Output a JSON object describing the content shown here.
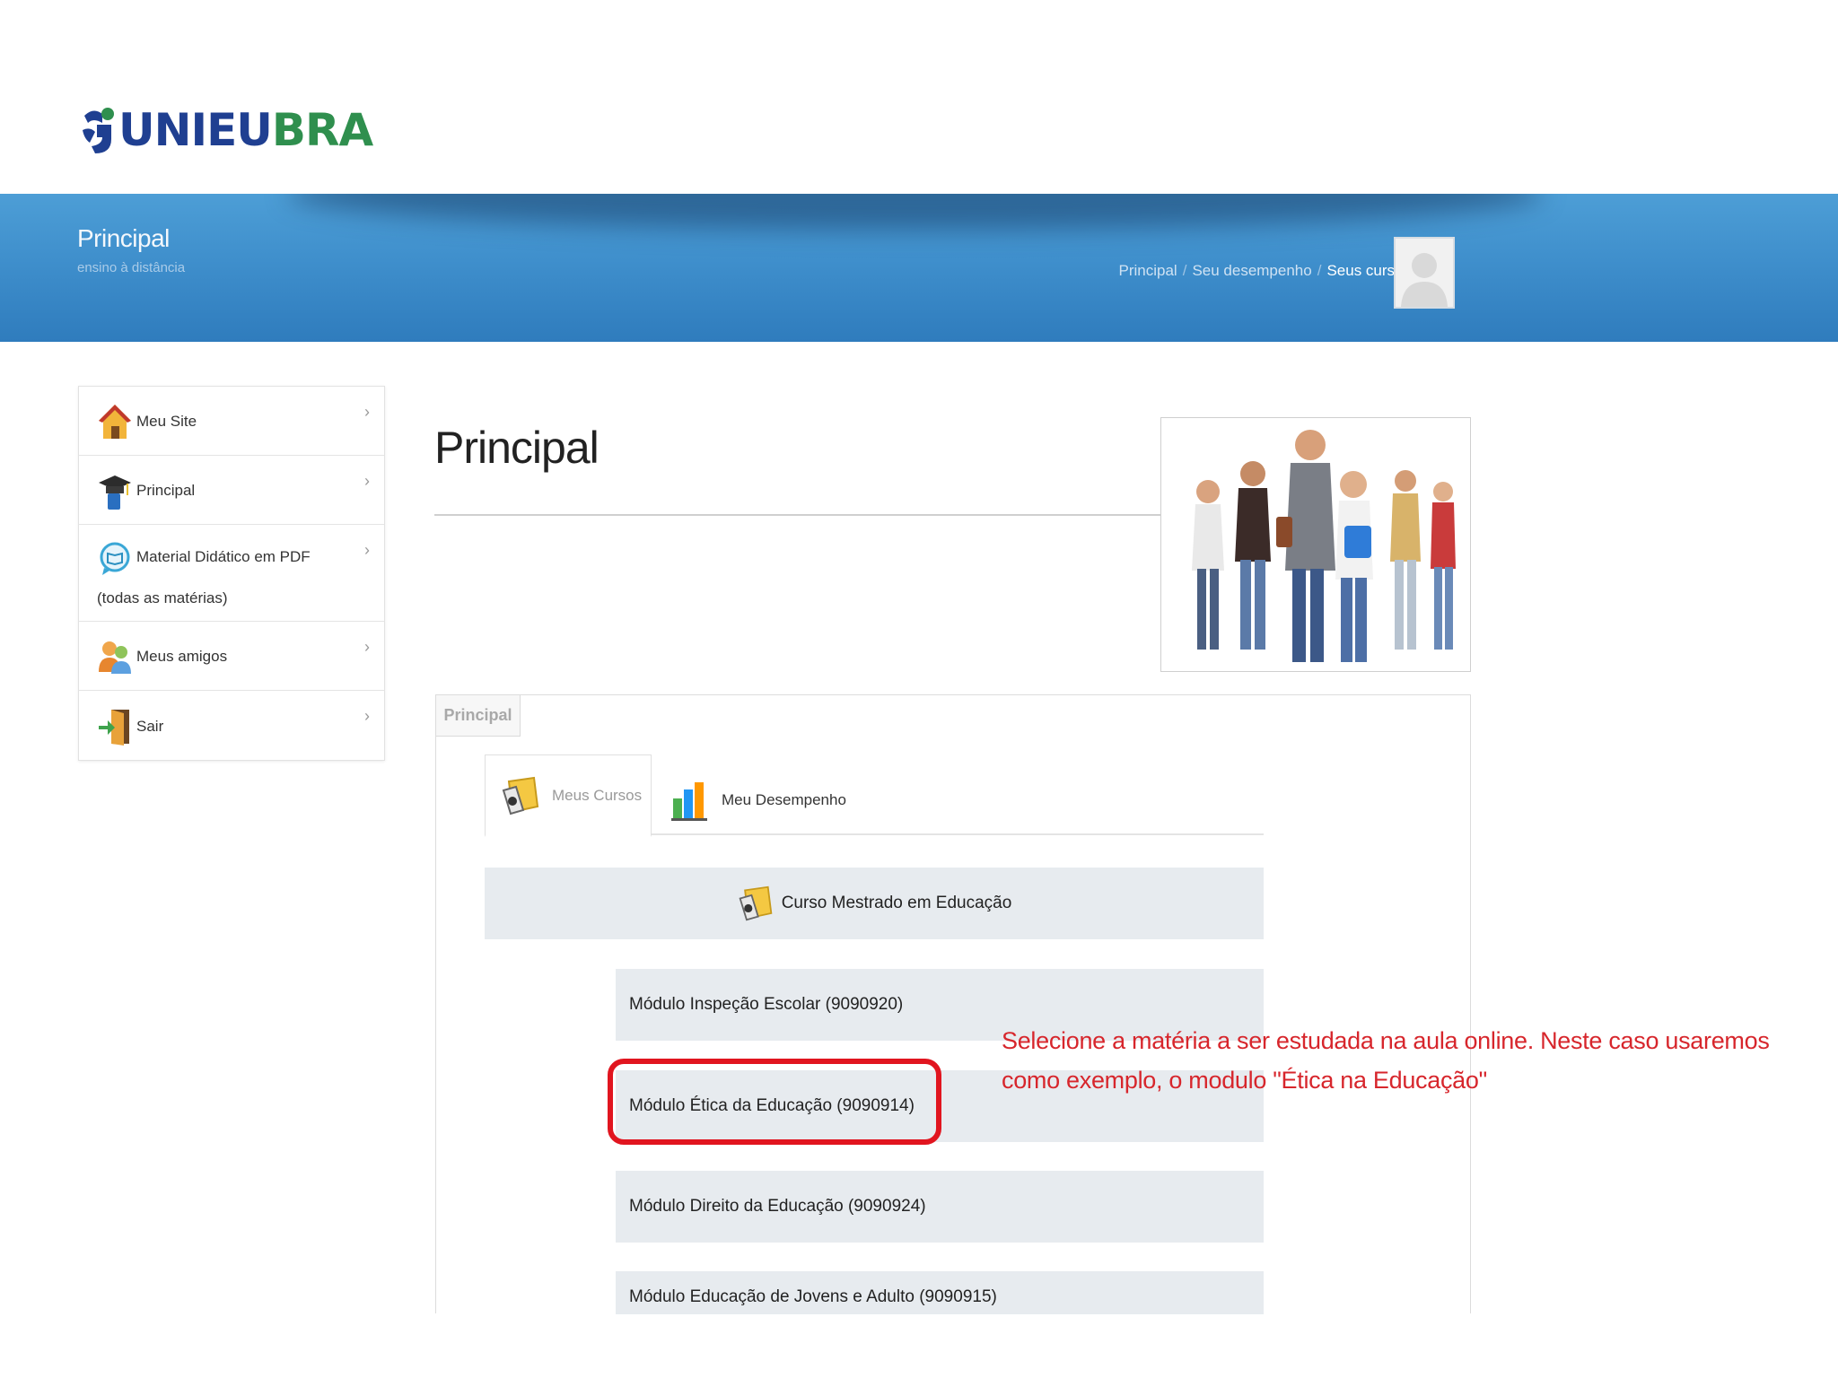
{
  "brand": {
    "logo_uni": "UNI",
    "logo_eu": "EU",
    "logo_bra": "BRA",
    "blue": "#1f3f91",
    "green": "#2f8f4e"
  },
  "header": {
    "title": "Principal",
    "subtitle": "ensino à distância",
    "breadcrumb": [
      "Principal",
      "Seu desempenho",
      "Seus cursos"
    ],
    "separator": "/",
    "band_color": "#3f8fcc"
  },
  "sidebar": {
    "items": [
      {
        "label": "Meu Site",
        "icon": "house-icon"
      },
      {
        "label": "Principal",
        "icon": "graduation-cap-icon"
      },
      {
        "label": "Material Didático em PDF",
        "label2": "(todas as matérias)",
        "icon": "book-bubble-icon"
      },
      {
        "label": "Meus amigos",
        "icon": "friends-icon"
      },
      {
        "label": "Sair",
        "icon": "exit-door-icon"
      }
    ],
    "chevron": "›"
  },
  "main": {
    "page_title": "Principal",
    "panel_tab": "Principal",
    "tabs": [
      {
        "label": "Meus Cursos",
        "icon": "courses-icon",
        "active": true
      },
      {
        "label": "Meu Desempenho",
        "icon": "bar-chart-icon",
        "active": false
      }
    ],
    "course": "Curso Mestrado em Educação",
    "modules": [
      "Módulo Inspeção Escolar (9090920)",
      "Módulo Ética da Educação (9090914)",
      "Módulo Direito da Educação (9090924)",
      "Módulo Educação de Jovens e Adulto (9090915)"
    ]
  },
  "annotation": {
    "text": "Selecione a matéria a ser estudada na aula online. Neste caso usaremos como exemplo, o modulo \"Ética na Educação\"",
    "color": "#d7262c"
  }
}
